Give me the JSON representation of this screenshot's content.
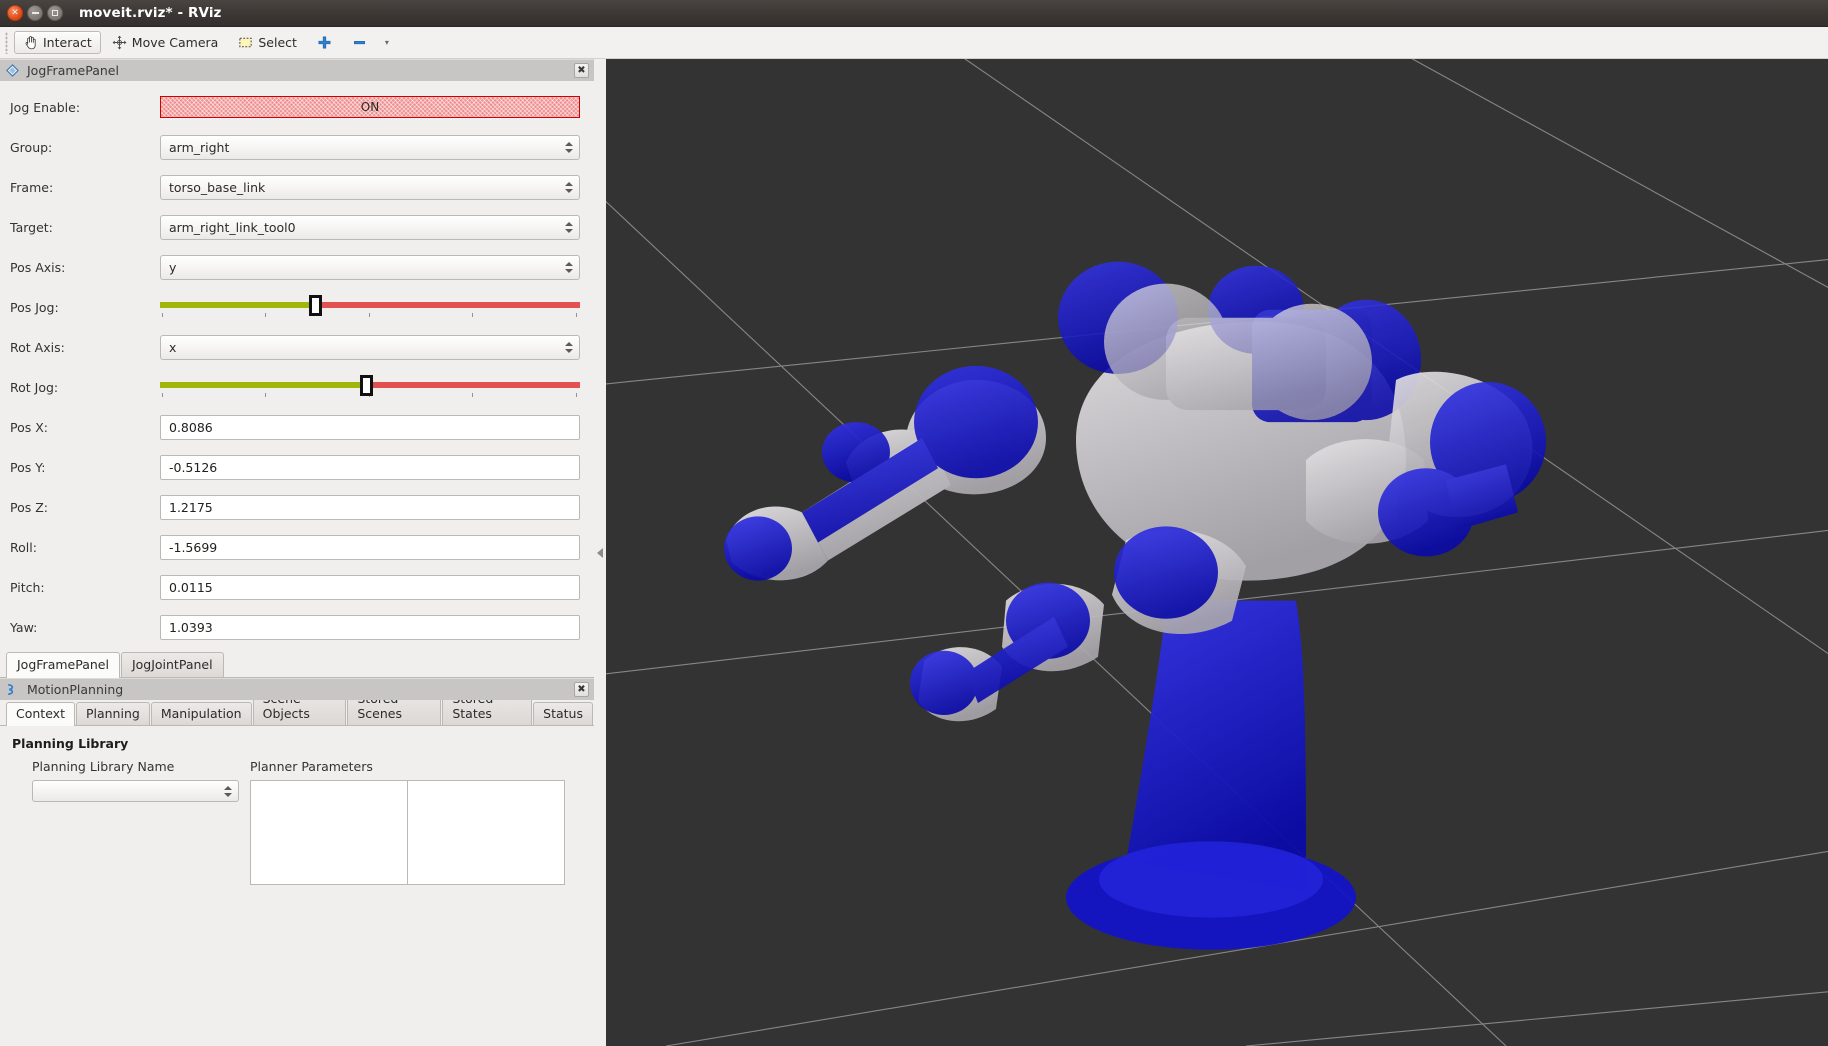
{
  "window": {
    "title": "moveit.rviz* - RViz",
    "close_glyph": "×",
    "minimize_glyph": "–",
    "maximize_glyph": "□"
  },
  "toolbar": {
    "items": [
      {
        "label": "Interact",
        "icon": "hand-cursor-icon",
        "active": true
      },
      {
        "label": "Move Camera",
        "icon": "move-camera-icon",
        "active": false
      },
      {
        "label": "Select",
        "icon": "select-rectangle-icon",
        "active": false
      },
      {
        "label": "",
        "icon": "plus-icon",
        "active": false
      },
      {
        "label": "",
        "icon": "minus-icon",
        "active": false
      }
    ],
    "overflow_glyph": "▾"
  },
  "jog_panel": {
    "header_title": "JogFramePanel",
    "close_glyph": "✖",
    "fields": {
      "jog_enable_label": "Jog Enable:",
      "jog_enable_value": "ON",
      "group_label": "Group:",
      "group_value": "arm_right",
      "frame_label": "Frame:",
      "frame_value": "torso_base_link",
      "target_label": "Target:",
      "target_value": "arm_right_link_tool0",
      "pos_axis_label": "Pos Axis:",
      "pos_axis_value": "y",
      "pos_jog_label": "Pos Jog:",
      "pos_jog_percent": 37,
      "rot_axis_label": "Rot Axis:",
      "rot_axis_value": "x",
      "rot_jog_label": "Rot Jog:",
      "rot_jog_percent": 49,
      "pos_x_label": "Pos X:",
      "pos_x_value": "0.8086",
      "pos_y_label": "Pos Y:",
      "pos_y_value": "-0.5126",
      "pos_z_label": "Pos Z:",
      "pos_z_value": "1.2175",
      "roll_label": "Roll:",
      "roll_value": "-1.5699",
      "pitch_label": "Pitch:",
      "pitch_value": "0.0115",
      "yaw_label": "Yaw:",
      "yaw_value": "1.0393"
    },
    "tabs": [
      {
        "label": "JogFramePanel",
        "selected": true
      },
      {
        "label": "JogJointPanel",
        "selected": false
      }
    ]
  },
  "motion_planning": {
    "header_title": "MotionPlanning",
    "close_glyph": "✖",
    "tabs": [
      {
        "label": "Context",
        "selected": true
      },
      {
        "label": "Planning",
        "selected": false
      },
      {
        "label": "Manipulation",
        "selected": false
      },
      {
        "label": "Scene Objects",
        "selected": false
      },
      {
        "label": "Stored Scenes",
        "selected": false
      },
      {
        "label": "Stored States",
        "selected": false
      },
      {
        "label": "Status",
        "selected": false
      }
    ],
    "context": {
      "group_title": "Planning Library",
      "library_name_label": "Planning Library Name",
      "library_name_value": "",
      "planner_params_label": "Planner Parameters"
    }
  },
  "viewport": {
    "background_color": "#333333",
    "grid_color": "#b9b9b9",
    "robot_primary_color": "#1a1ad0",
    "robot_ghost_color": "#c9c6c9"
  },
  "splitter": {
    "collapse_glyph": "◂"
  }
}
